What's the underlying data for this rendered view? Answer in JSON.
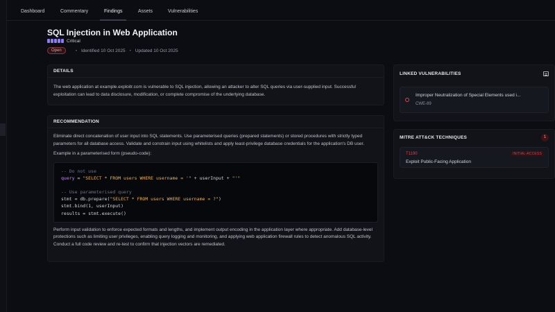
{
  "nav": {
    "tabs": [
      {
        "label": "Dashboard"
      },
      {
        "label": "Commentary"
      },
      {
        "label": "Findings",
        "active": true
      },
      {
        "label": "Assets"
      },
      {
        "label": "Vulnerabilities"
      }
    ]
  },
  "finding": {
    "title": "SQL Injection in Web Application",
    "severity": {
      "label": "Critical",
      "level": 5,
      "max": 5,
      "color": "#8b7df2"
    },
    "status": "Open",
    "identified": "Identified 10 Oct 2025",
    "updated": "Updated 10 Oct 2025"
  },
  "details": {
    "heading": "DETAILS",
    "text": "The web application at example.exploitr.com is vulnerable to SQL injection, allowing an attacker to alter SQL queries via user-supplied input. Successful exploitation can lead to data disclosure, modification, or complete compromise of the underlying database."
  },
  "recommendation": {
    "heading": "RECOMMENDATION",
    "intro": "Eliminate direct concatenation of user input into SQL statements. Use parameterised queries (prepared statements) or stored procedures with strictly typed parameters for all database access. Validate and constrain input using whitelists and apply least-privilege database credentials for the application's DB user.",
    "example_label": "Example in a parameterised form (pseudo-code):",
    "code": {
      "comment1": "-- Do not use",
      "line2_key": "query",
      "line2_rest": " = ",
      "line2_str1": "\"SELECT * FROM users WHERE username = '\"",
      "line2_mid": " + userInput + ",
      "line2_str2": "\"'\"",
      "comment2": "-- Use parameterised query",
      "line5_a": "stmt = db.prepare(",
      "line5_str": "\"SELECT * FROM users WHERE username = ?\"",
      "line5_b": ")",
      "line6": "stmt.bind(1, userInput)",
      "line7": "results = stmt.execute()"
    },
    "outro": "Perform input validation to enforce expected formats and lengths, and implement output encoding in the application layer where appropriate. Add database-level protections such as limiting user privileges, enabling query logging and monitoring, and applying web application firewall rules to detect anomalous SQL activity. Conduct a full code review and re-test to confirm that injection vectors are remediated."
  },
  "linked": {
    "heading": "LINKED VULNERABILITIES",
    "icon": "table-icon",
    "items": [
      {
        "name": "Improper Neutralization of Special Elements used i...",
        "cwe": "CWE-89",
        "color": "#d94a56"
      }
    ]
  },
  "mitre": {
    "heading": "MITRE ATT&CK TECHNIQUES",
    "count": "1",
    "items": [
      {
        "id": "T1190",
        "tactic": "INITIAL-ACCESS",
        "name": "Exploit Public-Facing Application",
        "color": "#d3434f"
      }
    ]
  }
}
